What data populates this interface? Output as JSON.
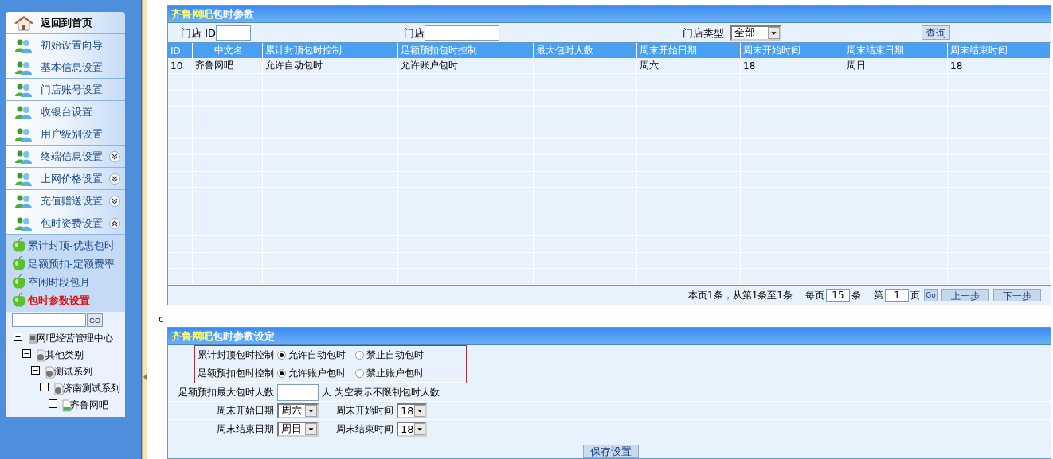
{
  "sidebar": {
    "items": [
      {
        "label": "返回到首页",
        "kind": "home"
      },
      {
        "label": "初始设置向导",
        "kind": "menu"
      },
      {
        "label": "基本信息设置",
        "kind": "menu"
      },
      {
        "label": "门店账号设置",
        "kind": "menu"
      },
      {
        "label": "收银台设置",
        "kind": "menu"
      },
      {
        "label": "用户级别设置",
        "kind": "menu"
      },
      {
        "label": "终端信息设置",
        "kind": "menu",
        "expanded": false
      },
      {
        "label": "上网价格设置",
        "kind": "menu",
        "expanded": false
      },
      {
        "label": "充值赠送设置",
        "kind": "menu",
        "expanded": false
      },
      {
        "label": "包时资费设置",
        "kind": "menu",
        "expanded": true
      }
    ],
    "sub_items": [
      {
        "label": "累计封顶-优惠包时",
        "selected": false
      },
      {
        "label": "足额预扣-定额费率",
        "selected": false
      },
      {
        "label": "空闲时段包月",
        "selected": false
      },
      {
        "label": "包时参数设置",
        "selected": true
      }
    ],
    "search_button": "GO",
    "tree": [
      {
        "label": "网吧经营管理中心",
        "kind": "root",
        "expanded": true,
        "children": [
          {
            "label": "其他类别",
            "kind": "group",
            "expanded": true,
            "children": [
              {
                "label": "测试系列",
                "kind": "group",
                "expanded": true,
                "children": [
                  {
                    "label": "济南测试系列",
                    "kind": "group",
                    "expanded": true,
                    "children": [
                      {
                        "label": "齐鲁网吧",
                        "kind": "leaf",
                        "expanded": false
                      }
                    ]
                  }
                ]
              }
            ]
          }
        ]
      }
    ]
  },
  "list_panel": {
    "title_highlight": "齐鲁网吧",
    "title": "包时参数",
    "filters": [
      {
        "label": "门店 ID",
        "kind": "text"
      },
      {
        "label": "门店",
        "kind": "text"
      },
      {
        "label": "门店类型",
        "kind": "select",
        "value": "全部"
      }
    ],
    "query_button": "查询",
    "columns": [
      "ID",
      "中文名",
      "累计封顶包时控制",
      "足额预扣包时控制",
      "最大包时人数",
      "周末开始日期",
      "周末开始时间",
      "周末结束日期",
      "周末结束时间"
    ],
    "rows": [
      [
        "10",
        "齐鲁网吧",
        "允许自动包时",
        "允许账户包时",
        "",
        "周六",
        "18",
        "周日",
        "18"
      ]
    ],
    "pager": {
      "summary": "本页1条，从第1条至1条",
      "per_page_label": "每页",
      "per_page": "15",
      "per_page_unit": "条",
      "page_label": "第",
      "page": "1",
      "page_unit": "页",
      "go": "Go",
      "prev": "上一步",
      "next": "下一步"
    }
  },
  "stray_text": "c",
  "settings_panel": {
    "title_highlight": "齐鲁网吧",
    "title": "包时参数设定",
    "radio_groups": [
      {
        "label": "累计封顶包时控制",
        "options": [
          {
            "label": "允许自动包时",
            "selected": true
          },
          {
            "label": "禁止自动包时",
            "selected": false
          }
        ]
      },
      {
        "label": "足额预扣包时控制",
        "options": [
          {
            "label": "允许账户包时",
            "selected": true
          },
          {
            "label": "禁止账户包时",
            "selected": false
          }
        ]
      }
    ],
    "max_users": {
      "label": "足额预扣最大包时人数",
      "unit": "人",
      "note": "为空表示不限制包时人数"
    },
    "select_rows": [
      [
        {
          "label": "周末开始日期",
          "value": "周六"
        },
        {
          "label": "周末开始时间",
          "value": "18"
        }
      ],
      [
        {
          "label": "周末结束日期",
          "value": "周日"
        },
        {
          "label": "周末结束时间",
          "value": "18"
        }
      ]
    ],
    "save_button": "保存设置"
  }
}
